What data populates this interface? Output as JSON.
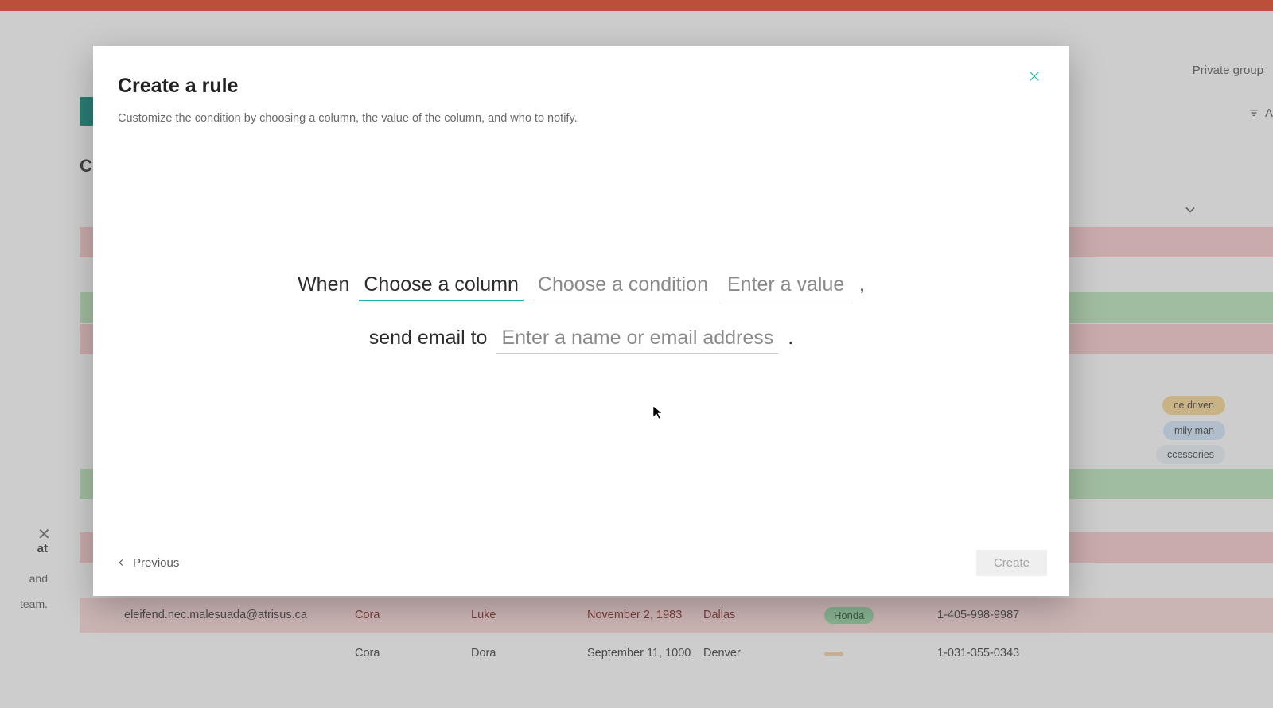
{
  "background": {
    "header_right": "Private group",
    "toolbar_right": "A",
    "left_heading_fragment": "Cu",
    "left_panel": {
      "line1": "at",
      "line2": "and",
      "line3": "team."
    },
    "tags": {
      "t1": "ce driven",
      "t2": "mily man",
      "t3": "ccessories"
    },
    "row_main": {
      "email": "eleifend.nec.malesuada@atrisus.ca",
      "first": "Cora",
      "last": "Luke",
      "date": "November 2, 1983",
      "city": "Dallas",
      "car": "Honda",
      "phone": "1-405-998-9987"
    },
    "row_partial": {
      "email": "",
      "first": "Cora",
      "last": "Dora",
      "date": "September 11, 1000",
      "city": "Denver",
      "car": "",
      "phone": "1-031-355-0343"
    }
  },
  "modal": {
    "title": "Create a rule",
    "subtitle": "Customize the condition by choosing a column, the value of the column, and who to notify.",
    "sentence1": {
      "prefix": "When",
      "column_placeholder": "Choose a column",
      "condition_placeholder": "Choose a condition",
      "value_placeholder": "Enter a value",
      "suffix": ","
    },
    "sentence2": {
      "prefix": "send email to",
      "recipient_placeholder": "Enter a name or email address",
      "suffix": "."
    },
    "previous_label": "Previous",
    "create_label": "Create"
  }
}
